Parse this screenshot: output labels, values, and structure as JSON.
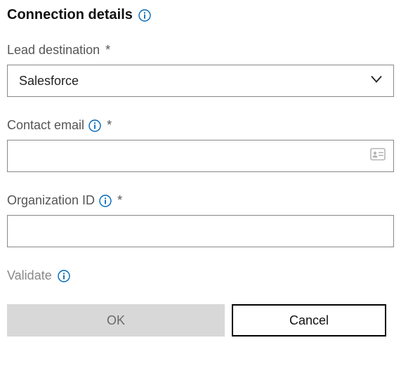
{
  "title": "Connection details",
  "fields": {
    "lead_destination": {
      "label": "Lead destination",
      "required_marker": "*",
      "value": "Salesforce"
    },
    "contact_email": {
      "label": "Contact email",
      "required_marker": "*",
      "value": ""
    },
    "organization_id": {
      "label": "Organization ID",
      "required_marker": "*",
      "value": ""
    }
  },
  "validate": {
    "label": "Validate"
  },
  "buttons": {
    "ok": "OK",
    "cancel": "Cancel"
  },
  "colors": {
    "info_icon": "#0067b8",
    "border": "#888",
    "disabled_bg": "#d8d8d8",
    "disabled_text": "#6a6a6a"
  }
}
